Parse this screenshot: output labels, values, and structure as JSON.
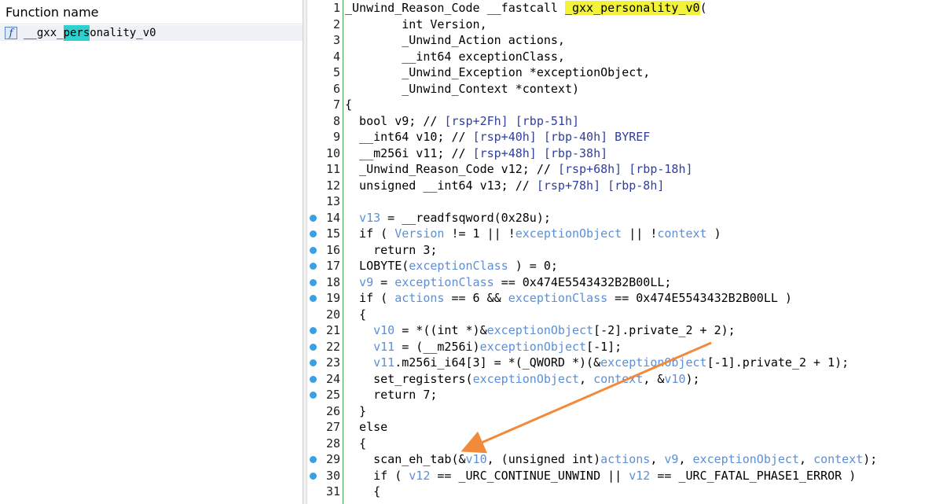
{
  "functions_panel": {
    "header": "Function name",
    "items": [
      {
        "icon": "function-icon",
        "name_pre": "__gxx_",
        "name_hl": "pers",
        "name_post": "onality_v0"
      }
    ]
  },
  "code": {
    "lines": [
      {
        "n": "1",
        "bp": false,
        "segs": [
          [
            "",
            "_Unwind_Reason_Code __fastcall "
          ],
          [
            "hl",
            "_g"
          ],
          [
            "hl",
            "xx_personality_v0"
          ],
          [
            "",
            "("
          ]
        ]
      },
      {
        "n": "2",
        "bp": false,
        "segs": [
          [
            "",
            "        int Version,"
          ]
        ]
      },
      {
        "n": "3",
        "bp": false,
        "segs": [
          [
            "",
            "        _Unwind_Action actions,"
          ]
        ]
      },
      {
        "n": "4",
        "bp": false,
        "segs": [
          [
            "",
            "        __int64 exceptionClass,"
          ]
        ]
      },
      {
        "n": "5",
        "bp": false,
        "segs": [
          [
            "",
            "        _Unwind_Exception *exceptionObject,"
          ]
        ]
      },
      {
        "n": "6",
        "bp": false,
        "segs": [
          [
            "",
            "        _Unwind_Context *context)"
          ]
        ]
      },
      {
        "n": "7",
        "bp": false,
        "segs": [
          [
            "",
            "{"
          ]
        ]
      },
      {
        "n": "8",
        "bp": false,
        "segs": [
          [
            "",
            "  bool v9; // "
          ],
          [
            "c",
            "[rsp+2Fh] [rbp-51h]"
          ]
        ]
      },
      {
        "n": "9",
        "bp": false,
        "segs": [
          [
            "",
            "  __int64 v10; // "
          ],
          [
            "c",
            "[rsp+40h] [rbp-40h] BYREF"
          ]
        ]
      },
      {
        "n": "10",
        "bp": false,
        "segs": [
          [
            "",
            "  __m256i v11; // "
          ],
          [
            "c",
            "[rsp+48h] [rbp-38h]"
          ]
        ]
      },
      {
        "n": "11",
        "bp": false,
        "segs": [
          [
            "",
            "  _Unwind_Reason_Code v12; // "
          ],
          [
            "c",
            "[rsp+68h] [rbp-18h]"
          ]
        ]
      },
      {
        "n": "12",
        "bp": false,
        "segs": [
          [
            "",
            "  unsigned __int64 v13; // "
          ],
          [
            "c",
            "[rsp+78h] [rbp-8h]"
          ]
        ]
      },
      {
        "n": "13",
        "bp": false,
        "segs": [
          [
            "",
            ""
          ]
        ]
      },
      {
        "n": "14",
        "bp": true,
        "segs": [
          [
            "v",
            "  v13"
          ],
          [
            "",
            " = __readfsqword(0x28u);"
          ]
        ]
      },
      {
        "n": "15",
        "bp": true,
        "segs": [
          [
            "",
            "  if ( "
          ],
          [
            "v",
            "Version"
          ],
          [
            "",
            " != 1 || !"
          ],
          [
            "v",
            "exceptionObject"
          ],
          [
            "",
            " || !"
          ],
          [
            "v",
            "context"
          ],
          [
            "",
            " )"
          ]
        ]
      },
      {
        "n": "16",
        "bp": true,
        "segs": [
          [
            "",
            "    return 3;"
          ]
        ]
      },
      {
        "n": "17",
        "bp": true,
        "segs": [
          [
            "",
            "  LOBYTE("
          ],
          [
            "v",
            "exceptionClass"
          ],
          [
            "",
            " ) = 0;"
          ]
        ]
      },
      {
        "n": "18",
        "bp": true,
        "segs": [
          [
            "v",
            "  v9"
          ],
          [
            "",
            " = "
          ],
          [
            "v",
            "exceptionClass"
          ],
          [
            "",
            " == 0x474E5543432B2B00LL;"
          ]
        ]
      },
      {
        "n": "19",
        "bp": true,
        "segs": [
          [
            "",
            "  if ( "
          ],
          [
            "v",
            "actions"
          ],
          [
            "",
            " == 6 && "
          ],
          [
            "v",
            "exceptionClass"
          ],
          [
            "",
            " == 0x474E5543432B2B00LL )"
          ]
        ]
      },
      {
        "n": "20",
        "bp": false,
        "segs": [
          [
            "",
            "  {"
          ]
        ]
      },
      {
        "n": "21",
        "bp": true,
        "segs": [
          [
            "v",
            "    v10"
          ],
          [
            "",
            " = *((int *)&"
          ],
          [
            "v",
            "exceptionObject"
          ],
          [
            "",
            "[-2].private_2 + 2);"
          ]
        ]
      },
      {
        "n": "22",
        "bp": true,
        "segs": [
          [
            "v",
            "    v11"
          ],
          [
            "",
            " = (__m256i)"
          ],
          [
            "v",
            "exceptionObject"
          ],
          [
            "",
            "[-1];"
          ]
        ]
      },
      {
        "n": "23",
        "bp": true,
        "segs": [
          [
            "v",
            "    v11"
          ],
          [
            "",
            ".m256i_i64[3] = *(_QWORD *)(&"
          ],
          [
            "v",
            "exceptionObject"
          ],
          [
            "",
            "[-1].private_2 + 1);"
          ]
        ]
      },
      {
        "n": "24",
        "bp": true,
        "segs": [
          [
            "",
            "    set_registers("
          ],
          [
            "v",
            "exceptionObject"
          ],
          [
            "",
            ", "
          ],
          [
            "v",
            "context"
          ],
          [
            "",
            ", &"
          ],
          [
            "v",
            "v10"
          ],
          [
            "",
            ");"
          ]
        ]
      },
      {
        "n": "25",
        "bp": true,
        "segs": [
          [
            "",
            "    return 7;"
          ]
        ]
      },
      {
        "n": "26",
        "bp": false,
        "segs": [
          [
            "",
            "  }"
          ]
        ]
      },
      {
        "n": "27",
        "bp": false,
        "segs": [
          [
            "",
            "  else"
          ]
        ]
      },
      {
        "n": "28",
        "bp": false,
        "segs": [
          [
            "",
            "  {"
          ]
        ]
      },
      {
        "n": "29",
        "bp": true,
        "segs": [
          [
            "",
            "    scan_eh_tab(&"
          ],
          [
            "v",
            "v10"
          ],
          [
            "",
            ", (unsigned int)"
          ],
          [
            "v",
            "actions"
          ],
          [
            "",
            ", "
          ],
          [
            "v",
            "v9"
          ],
          [
            "",
            ", "
          ],
          [
            "v",
            "exceptionObject"
          ],
          [
            "",
            ", "
          ],
          [
            "v",
            "context"
          ],
          [
            "",
            ");"
          ]
        ]
      },
      {
        "n": "30",
        "bp": true,
        "segs": [
          [
            "",
            "    if ( "
          ],
          [
            "v",
            "v12"
          ],
          [
            "",
            " == _URC_CONTINUE_UNWIND || "
          ],
          [
            "v",
            "v12"
          ],
          [
            "",
            " == _URC_FATAL_PHASE1_ERROR )"
          ]
        ]
      },
      {
        "n": "31",
        "bp": false,
        "segs": [
          [
            "",
            "    {"
          ]
        ]
      }
    ]
  },
  "annotation": {
    "color": "#f28a3c"
  }
}
